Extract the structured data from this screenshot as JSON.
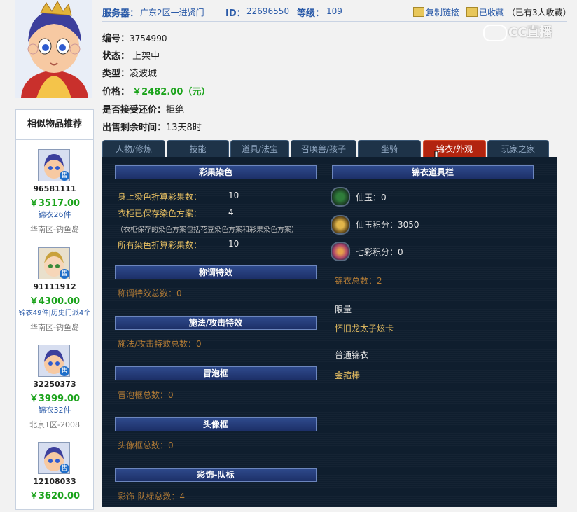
{
  "header": {
    "server_label": "服务器：",
    "server_value": "广东2区一进贤门",
    "id_label": "ID：",
    "id_value": "22696550",
    "level_label": "等级：",
    "level_value": "109",
    "copy_link": "复制链接",
    "favorited": "已收藏",
    "fav_count": "（已有3人收藏）"
  },
  "watermark": "CC直播",
  "info": {
    "serial_label": "编号：",
    "serial_value": "3754990",
    "status_label": "状态：",
    "status_value": "上架中",
    "type_label": "类型：",
    "type_value": "凌波城",
    "price_label": "价格：",
    "price_value": "￥2482.00（元）",
    "bargain_label": "是否接受还价：",
    "bargain_value": "拒绝",
    "time_label": "出售剩余时间：",
    "time_value": "13天8时"
  },
  "sidebar": {
    "title": "相似物品推荐",
    "badge": "售",
    "items": [
      {
        "id": "96581111",
        "price": "￥3517.00",
        "desc": "锦衣26件",
        "region": "华南区-钓鱼岛"
      },
      {
        "id": "91111912",
        "price": "￥4300.00",
        "desc": "锦衣49件|历史门派4个",
        "region": "华南区-钓鱼岛"
      },
      {
        "id": "32250373",
        "price": "￥3999.00",
        "desc": "锦衣32件",
        "region": "北京1区-2008"
      },
      {
        "id": "12108033",
        "price": "￥3620.00",
        "desc": "",
        "region": ""
      }
    ]
  },
  "tabs": [
    "人物/修炼",
    "技能",
    "道具/法宝",
    "召唤兽/孩子",
    "坐骑",
    "锦衣/外观",
    "玩家之家"
  ],
  "active_tab": "锦衣/外观",
  "left": {
    "dye_title": "彩果染色",
    "dye_rows": [
      {
        "label": "身上染色折算彩果数：",
        "value": "10"
      },
      {
        "label": "衣柜已保存染色方案：",
        "value": "4"
      }
    ],
    "dye_note": "（衣柜保存的染色方案包括花豆染色方案和彩果染色方案）",
    "dye_total_label": "所有染色折算彩果数：",
    "dye_total_value": "10",
    "title_effect_title": "称谓特效",
    "title_effect_row": "称谓特效总数：0",
    "spell_title": "施法/攻击特效",
    "spell_row": "施法/攻击特效总数：0",
    "bubble_title": "冒泡框",
    "bubble_row": "冒泡框总数：0",
    "portrait_title": "头像框",
    "portrait_row": "头像框总数：0",
    "team_title": "彩饰-队标",
    "team_row": "彩饰-队标总数：4"
  },
  "right": {
    "title": "锦衣道具栏",
    "items": [
      {
        "label": "仙玉：0",
        "icon": "jade-coin-icon"
      },
      {
        "label": "仙玉积分：3050",
        "icon": "jade-points-icon"
      },
      {
        "label": "七彩积分：0",
        "icon": "rainbow-points-icon"
      }
    ],
    "total": "锦衣总数：2",
    "limited_heading": "限量",
    "limited_item": "怀旧龙太子炫卡",
    "normal_heading": "普通锦衣",
    "normal_item": "金箍棒"
  },
  "colors": {
    "link_blue": "#2a5aa8",
    "price_green": "#1ba31b",
    "panel_bg": "#0f1e2e",
    "active_tab": "#b2240f",
    "gold_text": "#e8c062"
  }
}
